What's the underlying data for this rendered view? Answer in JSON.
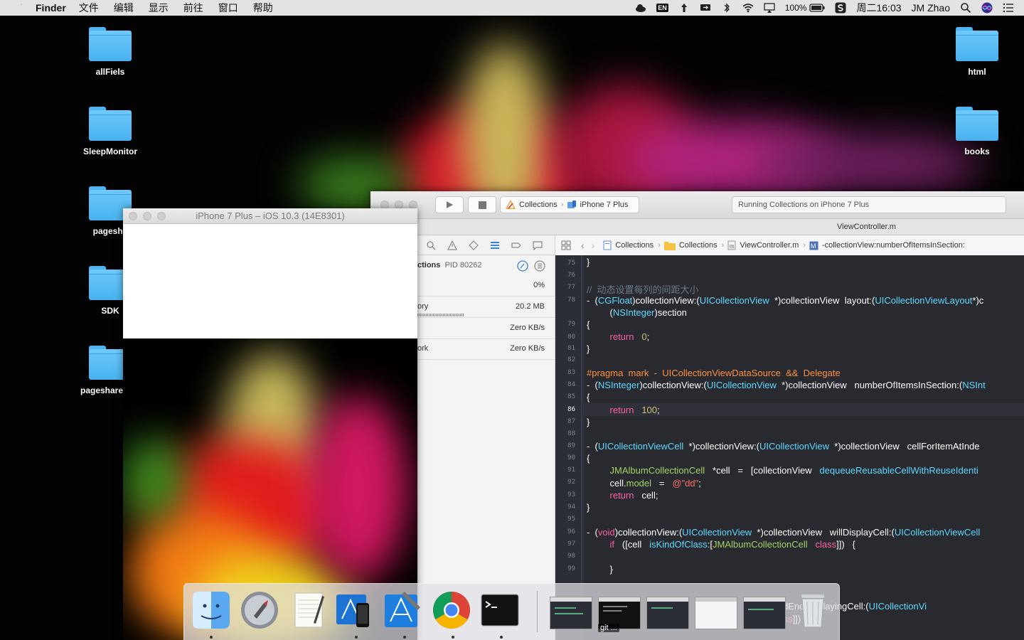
{
  "menubar": {
    "app_name": "Finder",
    "menus": [
      "文件",
      "编辑",
      "显示",
      "前往",
      "窗口",
      "帮助"
    ],
    "input_method": "EN",
    "battery": "100%",
    "clock": "周二16:03",
    "user": "JM Zhao"
  },
  "desktop": {
    "left_icons": [
      "allFiels",
      "SleepMonitor",
      "pagesha",
      "SDK",
      "pageshare"
    ],
    "right_icons": [
      "html",
      "books"
    ]
  },
  "xcode": {
    "scheme_project": "Collections",
    "scheme_device": "iPhone 7 Plus",
    "activity_status": "Running Collections on iPhone 7 Plus",
    "tab_title": "ViewController.m",
    "jumpbar": [
      "Collections",
      "Collections",
      "ViewController.m",
      "-collectionView:numberOfItemsInSection:"
    ],
    "debug_nav": {
      "process_label": "ctions",
      "pid": "PID 80262",
      "cpu": "0%",
      "memory_label": "ory",
      "memory": "20.2 MB",
      "disk": "Zero KB/s",
      "network_label": "ork",
      "network": "Zero KB/s"
    },
    "line_numbers": [
      "75",
      "76",
      "77",
      "78",
      "79",
      "80",
      "81",
      "82",
      "83",
      "84",
      "85",
      "86",
      "87",
      "88",
      "89",
      "90",
      "91",
      "92",
      "93",
      "94",
      "95",
      "96",
      "97",
      "98",
      "99"
    ],
    "current_line": "86"
  },
  "simulator": {
    "title": "iPhone 7 Plus – iOS 10.3 (14E8301)"
  },
  "dock": {
    "apps": [
      "finder-icon",
      "launchpad-icon",
      "textedit-icon",
      "xcode-simulator-icon",
      "xcode-icon",
      "chrome-icon",
      "terminal-icon",
      "trash-icon"
    ],
    "git_label": "git ..."
  }
}
